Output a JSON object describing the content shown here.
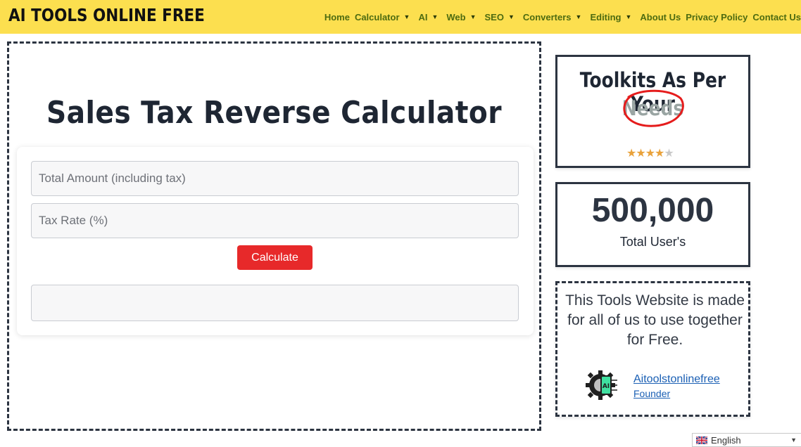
{
  "header": {
    "logo": "AI TOOLS ONLINE FREE",
    "nav": [
      {
        "label": "Home",
        "dropdown": false
      },
      {
        "label": "Calculator",
        "dropdown": true
      },
      {
        "label": "AI",
        "dropdown": true
      },
      {
        "label": "Web",
        "dropdown": true
      },
      {
        "label": "SEO",
        "dropdown": true
      },
      {
        "label": "Converters",
        "dropdown": true
      },
      {
        "label": "Editing",
        "dropdown": true
      },
      {
        "label": "About Us",
        "dropdown": false
      },
      {
        "label": "Privacy Policy",
        "dropdown": false
      },
      {
        "label": "Contact Us",
        "dropdown": false
      }
    ]
  },
  "main": {
    "title": "Sales Tax Reverse Calculator",
    "total_placeholder": "Total Amount (including tax)",
    "rate_placeholder": "Tax Rate (%)",
    "calculate_label": "Calculate",
    "result": ""
  },
  "sidebar": {
    "toolkits_title": "Toolkits As Per Your",
    "toolkits_highlight": "Needs",
    "rating": 4.5,
    "users_count": "500,000",
    "users_label": "Total User's",
    "about_text": "This Tools Website is made for all of us to use together for Free.",
    "founder_name": "Aitoolstonlinefree",
    "founder_role": "Founder"
  },
  "language": {
    "selected": "English"
  },
  "colors": {
    "header_bg": "#fcdf4f",
    "nav_text": "#4d6b10",
    "button_bg": "#e7292a",
    "border": "#2c3441",
    "link": "#1a5fb4"
  }
}
